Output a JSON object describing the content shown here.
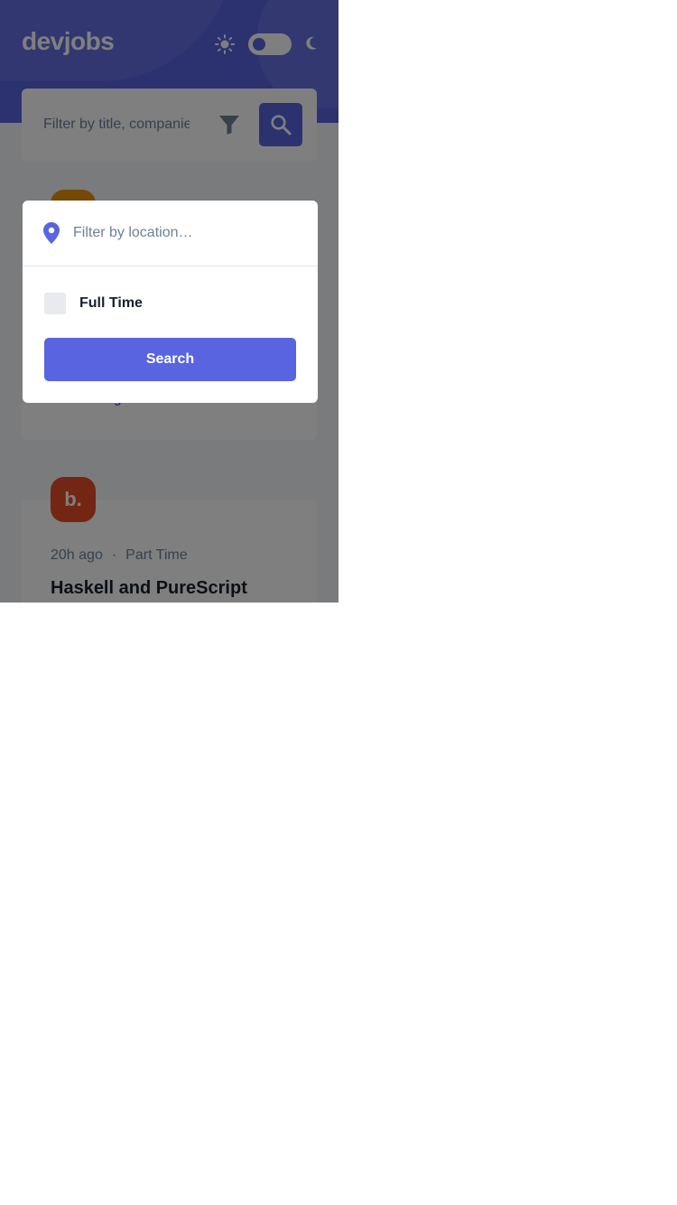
{
  "header": {
    "logo": "devjobs",
    "sun_icon": "sun-icon",
    "moon_icon": "moon-icon",
    "dark_mode": false
  },
  "search": {
    "title_placeholder": "Filter by title, companies, expertise…",
    "filter_icon": "filter-icon",
    "search_icon": "search-icon"
  },
  "jobs": [
    {
      "logo_text": "",
      "logo_color": "#e99210",
      "location": "United Kingdom"
    },
    {
      "logo_text": "b.",
      "logo_color": "#e54d26",
      "posted": "20h ago",
      "separator": "·",
      "contract": "Part Time",
      "title": "Haskell and PureScript"
    }
  ],
  "modal": {
    "location_icon": "location-pin-icon",
    "location_placeholder": "Filter by location…",
    "full_time_label": "Full Time",
    "full_time_checked": false,
    "search_label": "Search"
  },
  "colors": {
    "accent": "#5964e0",
    "text_dark": "#19202d",
    "text_gray": "#6e8098"
  }
}
